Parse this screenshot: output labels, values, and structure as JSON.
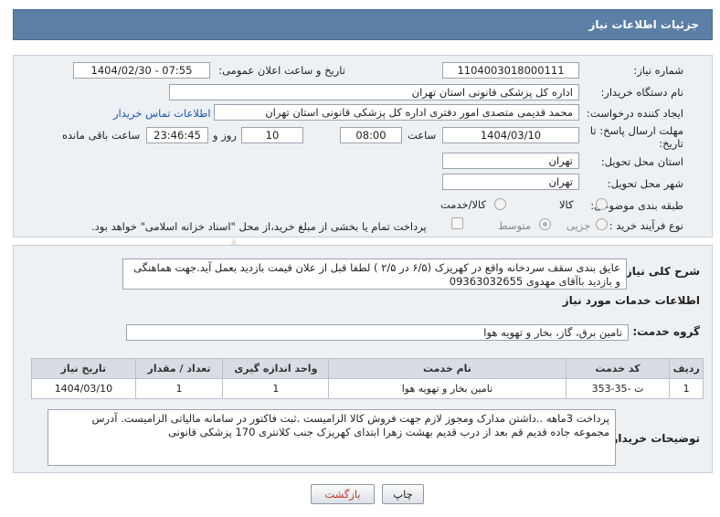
{
  "header": {
    "title": "جزئیات اطلاعات نیاز"
  },
  "form": {
    "need_number_label": "شماره نیاز:",
    "need_number": "1104003018000111",
    "announce_label": "تاریخ و ساعت اعلان عمومی:",
    "announce_value": "1404/02/30 - 07:55",
    "buyer_org_label": "نام دستگاه خریدار:",
    "buyer_org": "اداره کل پزشکی قانونی استان تهران",
    "creator_label": "ایجاد کننده درخواست:",
    "creator": "محمد قدیمی متصدی امور دفتری اداره کل پزشکی قانونی استان تهران",
    "contact_link": "اطلاعات تماس خریدار",
    "deadline_label_1": "مهلت ارسال پاسخ: تا",
    "deadline_label_2": "تاریخ:",
    "deadline_date": "1404/03/10",
    "time_label": "ساعت",
    "deadline_time": "08:00",
    "days_value": "10",
    "days_label": "روز و",
    "remaining_time": "23:46:45",
    "remaining_label": "ساعت باقی مانده",
    "delivery_province_label": "استان محل تحویل:",
    "delivery_province": "تهران",
    "delivery_city_label": "شهر محل تحویل:",
    "delivery_city": "تهران",
    "category_label": "طبقه بندی موضوعی:",
    "category_options": [
      "کالا",
      "کالا/خدمت"
    ],
    "process_label": "نوع فرآیند خرید :",
    "process_options": [
      "جزیی",
      "متوسط"
    ],
    "payment_note": "پرداخت تمام یا بخشی از مبلغ خرید،از محل \"اسناد خزانه اسلامی\" خواهد بود."
  },
  "description": {
    "label": "شرح کلی نیاز:",
    "text": "عایق بندی سقف سردخانه واقع در کهریزک (۶/۵ در ۲/۵ ) لطفا قبل از علان قیمت بازدید بعمل آید.جهت هماهنگی و بازدید باآقای مهدوی 09363032655"
  },
  "services": {
    "section_title": "اطلاعات خدمات مورد نیاز",
    "group_label": "گروه خدمت:",
    "group_value": "تامین برق، گاز، بخار و تهویه هوا",
    "columns": [
      "ردیف",
      "کد خدمت",
      "نام خدمت",
      "واحد اندازه گیری",
      "تعداد / مقدار",
      "تاریخ نیاز"
    ],
    "rows": [
      [
        "1",
        "ت -35-353",
        "تامین بخار و تهویه هوا",
        "1",
        "1",
        "1404/03/10"
      ]
    ]
  },
  "buyer_notes": {
    "label": "توضیحات خریدار:",
    "text": "پرداخت 3ماهه ..داشتن مدارک ومجوز لازم جهت فروش کالا الزامیست .ثبت فاکتور در سامانه مالیاتی الزامیست. آدرس مجموعه جاده قدیم قم بعد از درب قدیم بهشت زهرا ابتدای کهریزک جنب کلانتری 170 پزشکی قانونی"
  },
  "buttons": {
    "print": "چاپ",
    "back": "بازگشت"
  },
  "colors": {
    "header_bg": "#5c7fa6",
    "panel_bg": "#eef1f4",
    "link": "#1a55b3"
  }
}
